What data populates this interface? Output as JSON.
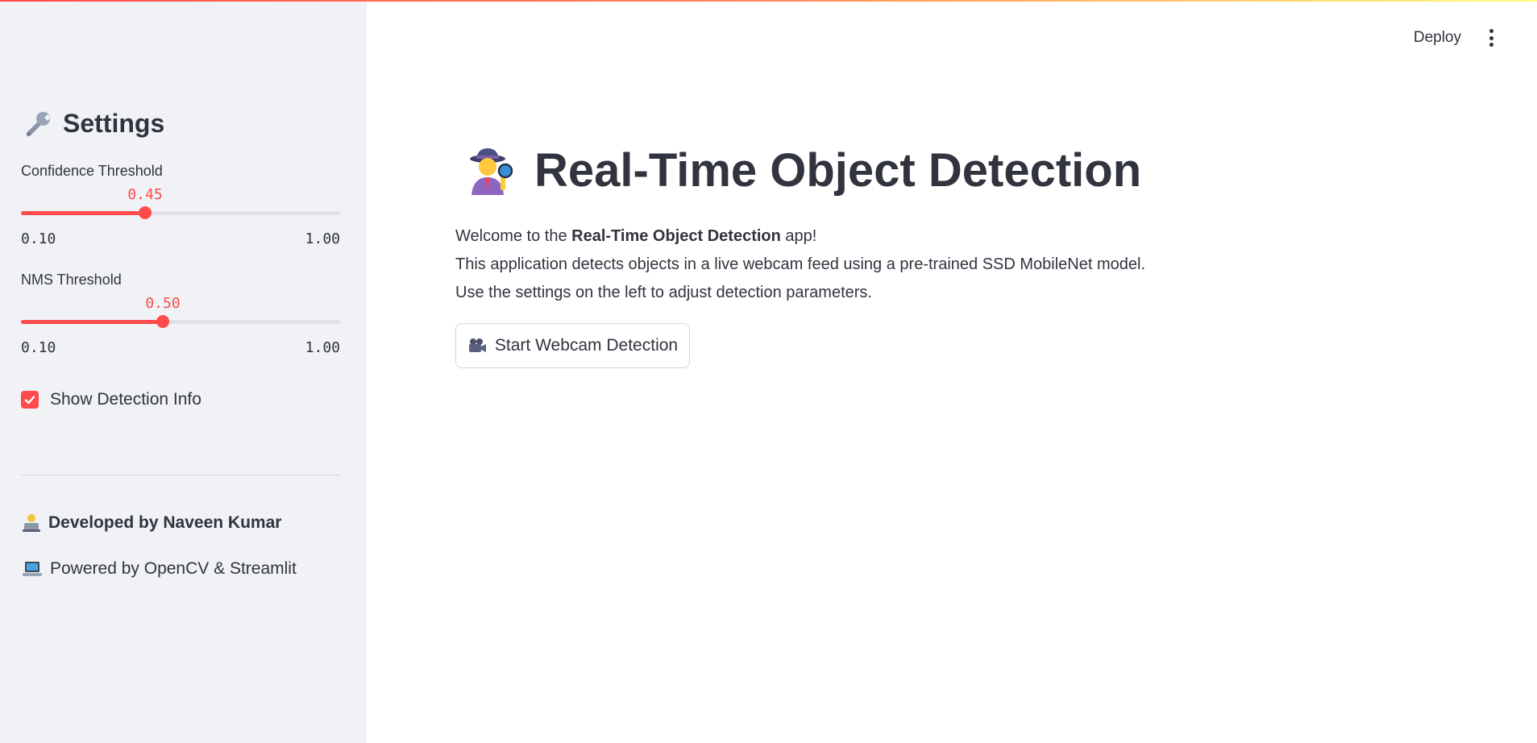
{
  "header": {
    "deploy_label": "Deploy",
    "menu_icon": "kebab-menu-icon"
  },
  "sidebar": {
    "title": "Settings",
    "title_icon": "wrench-icon",
    "confidence": {
      "label": "Confidence Threshold",
      "value": "0.45",
      "min": "0.10",
      "max": "1.00",
      "fraction": 0.389
    },
    "nms": {
      "label": "NMS Threshold",
      "value": "0.50",
      "min": "0.10",
      "max": "1.00",
      "fraction": 0.444
    },
    "show_info": {
      "label": "Show Detection Info",
      "checked": true
    },
    "credits": {
      "developer": "Developed by Naveen Kumar",
      "developer_icon": "technologist-icon",
      "powered": "Powered by OpenCV & Streamlit",
      "powered_icon": "laptop-icon"
    }
  },
  "main": {
    "title": "Real-Time Object Detection",
    "title_icon": "detective-icon",
    "intro_prefix": "Welcome to the ",
    "intro_bold": "Real-Time Object Detection",
    "intro_suffix": " app!",
    "line2": "This application detects objects in a live webcam feed using a pre-trained SSD MobileNet model.",
    "line3": "Use the settings on the left to adjust detection parameters.",
    "start_button": "Start Webcam Detection",
    "start_icon": "movie-camera-icon"
  },
  "colors": {
    "accent": "#ff4b4b",
    "sidebar_bg": "#f0f2f6",
    "text": "#31333f"
  }
}
